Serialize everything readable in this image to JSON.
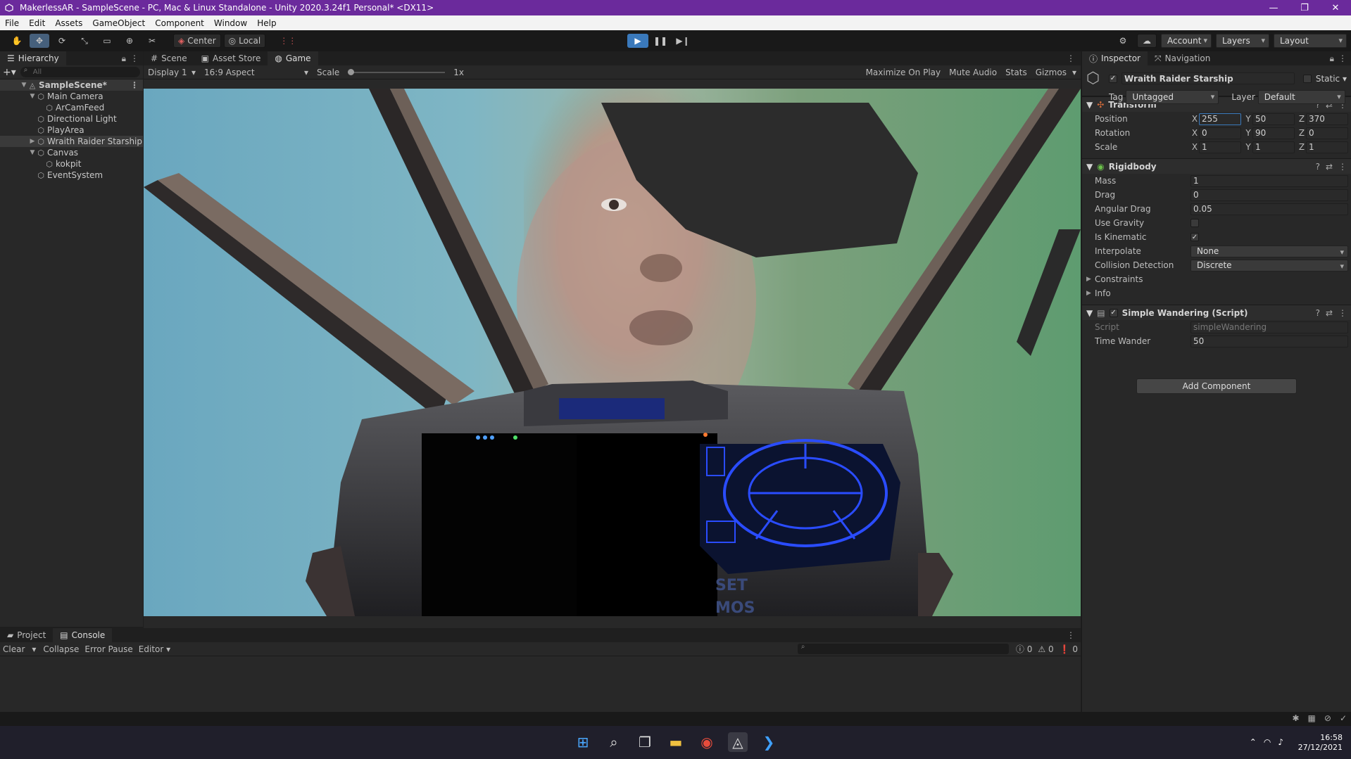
{
  "window": {
    "title": "MakerlessAR - SampleScene - PC, Mac & Linux Standalone - Unity 2020.3.24f1 Personal* <DX11>"
  },
  "menu": [
    "File",
    "Edit",
    "Assets",
    "GameObject",
    "Component",
    "Window",
    "Help"
  ],
  "toolbar": {
    "center_label": "Center",
    "local_label": "Local",
    "account_label": "Account",
    "layers_label": "Layers",
    "layout_label": "Layout"
  },
  "hierarchy": {
    "tab_label": "Hierarchy",
    "search_placeholder": "All",
    "scene": "SampleScene*",
    "items": [
      {
        "label": "Main Camera",
        "depth": 1,
        "caret": "▼"
      },
      {
        "label": "ArCamFeed",
        "depth": 2,
        "caret": ""
      },
      {
        "label": "Directional Light",
        "depth": 1,
        "caret": ""
      },
      {
        "label": "PlayArea",
        "depth": 1,
        "caret": ""
      },
      {
        "label": "Wraith Raider Starship",
        "depth": 1,
        "caret": "▶"
      },
      {
        "label": "Canvas",
        "depth": 1,
        "caret": "▼"
      },
      {
        "label": "kokpit",
        "depth": 2,
        "caret": ""
      },
      {
        "label": "EventSystem",
        "depth": 1,
        "caret": ""
      }
    ]
  },
  "center_tabs": {
    "scene": "Scene",
    "asset_store": "Asset Store",
    "game": "Game"
  },
  "game_bar": {
    "display": "Display 1",
    "aspect": "16:9 Aspect",
    "scale_label": "Scale",
    "scale_value": "1x",
    "maximize": "Maximize On Play",
    "mute": "Mute Audio",
    "stats": "Stats",
    "gizmos": "Gizmos"
  },
  "hud_text": {
    "line1": "SET",
    "line2": "MOS"
  },
  "inspector": {
    "tab_label": "Inspector",
    "nav_tab_label": "Navigation",
    "object_name": "Wraith Raider Starship",
    "static_label": "Static",
    "tag_label": "Tag",
    "tag_value": "Untagged",
    "layer_label": "Layer",
    "layer_value": "Default",
    "transform": {
      "title": "Transform",
      "position_label": "Position",
      "position": [
        "255",
        "50",
        "370"
      ],
      "rotation_label": "Rotation",
      "rotation": [
        "0",
        "90",
        "0"
      ],
      "scale_label": "Scale",
      "scale": [
        "1",
        "1",
        "1"
      ]
    },
    "rigidbody": {
      "title": "Rigidbody",
      "mass_label": "Mass",
      "mass": "1",
      "drag_label": "Drag",
      "drag": "0",
      "angular_drag_label": "Angular Drag",
      "angular_drag": "0.05",
      "use_gravity_label": "Use Gravity",
      "use_gravity": "",
      "is_kinematic_label": "Is Kinematic",
      "is_kinematic": "✓",
      "interpolate_label": "Interpolate",
      "interpolate": "None",
      "collision_label": "Collision Detection",
      "collision": "Discrete",
      "constraints_label": "Constraints",
      "info_label": "Info"
    },
    "script": {
      "title": "Simple Wandering (Script)",
      "script_label": "Script",
      "script_value": "simpleWandering",
      "time_wander_label": "Time Wander",
      "time_wander": "50"
    },
    "add_component": "Add Component"
  },
  "console": {
    "project_tab": "Project",
    "console_tab": "Console",
    "clear": "Clear",
    "collapse": "Collapse",
    "error_pause": "Error Pause",
    "editor": "Editor",
    "count_info": "0",
    "count_warn": "0",
    "count_err": "0"
  },
  "clock": {
    "time": "16:58",
    "date": "27/12/2021"
  },
  "colors": {
    "title_bar": "#6b2a9c",
    "play_active": "#3a79bb",
    "hud_blue": "#2a4cff"
  }
}
